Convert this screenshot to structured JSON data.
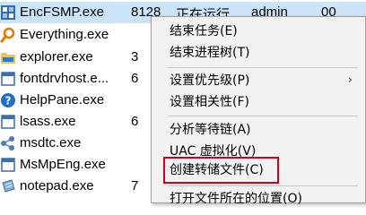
{
  "processes": [
    {
      "name": "EncFSMP.exe",
      "pid": "8128",
      "status": "正在运行",
      "user": "admin",
      "desc": "00",
      "icon": "encfsmp-icon",
      "selected": true
    },
    {
      "name": "Everything.exe",
      "pid": "",
      "status": "",
      "user": "",
      "desc": "",
      "icon": "everything-search-icon"
    },
    {
      "name": "explorer.exe",
      "pid": "3",
      "status": "",
      "user": "",
      "desc": "",
      "icon": "explorer-folder-icon"
    },
    {
      "name": "fontdrvhost.e...",
      "pid": "6",
      "status": "",
      "user": "",
      "desc": "",
      "icon": "fontdrvhost-icon"
    },
    {
      "name": "HelpPane.exe",
      "pid": "",
      "status": "",
      "user": "",
      "desc": "",
      "icon": "help-icon"
    },
    {
      "name": "lsass.exe",
      "pid": "6",
      "status": "",
      "user": "",
      "desc": "",
      "icon": "lsass-icon"
    },
    {
      "name": "msdtc.exe",
      "pid": "",
      "status": "",
      "user": "",
      "desc": "",
      "icon": "msdtc-icon"
    },
    {
      "name": "MsMpEng.exe",
      "pid": "",
      "status": "",
      "user": "",
      "desc": "",
      "icon": "msmpeng-icon"
    },
    {
      "name": "notepad.exe",
      "pid": "7",
      "status": "",
      "user": "",
      "desc": "",
      "icon": "notepad-icon"
    }
  ],
  "context_menu": {
    "end_task": "结束任务(E)",
    "end_process_tree": "结束进程树(T)",
    "set_priority": "设置优先级(P)",
    "set_affinity": "设置相关性(F)",
    "analyze_wait_chain": "分析等待链(A)",
    "uac_virtualization": "UAC 虚拟化(V)",
    "create_dump_file": "创建转储文件(C)",
    "open_file_location": "打开文件所在的位置(O)",
    "submenu_arrow": "›"
  },
  "colors": {
    "selection": "#cce4f7",
    "highlight_box": "#d0021b",
    "menu_background": "#f2f2f2"
  }
}
